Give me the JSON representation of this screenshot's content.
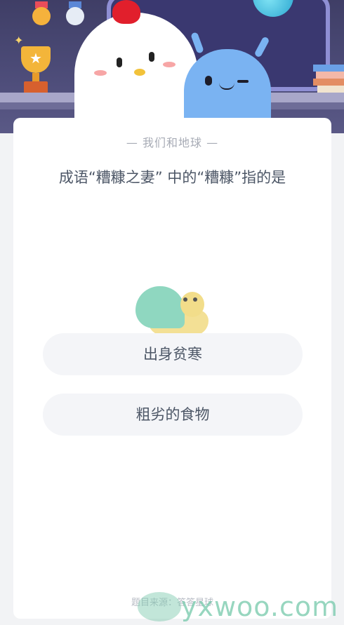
{
  "header": {
    "illustration": "quiz-banner-illustration"
  },
  "card": {
    "tag": "— 我们和地球 —",
    "question": "成语“糟糠之妻” 中的“糟糠”指的是",
    "options": [
      {
        "label": "出身贫寒"
      },
      {
        "label": "粗劣的食物"
      }
    ],
    "footer_note": "题目来源：答答星球"
  },
  "watermark": {
    "text": "yxwoo.com"
  },
  "colors": {
    "banner": "#4e4d7a",
    "card": "#ffffff",
    "option_bg": "#f4f5f8",
    "text": "#4c5666",
    "watermark": "#74c8aa"
  }
}
